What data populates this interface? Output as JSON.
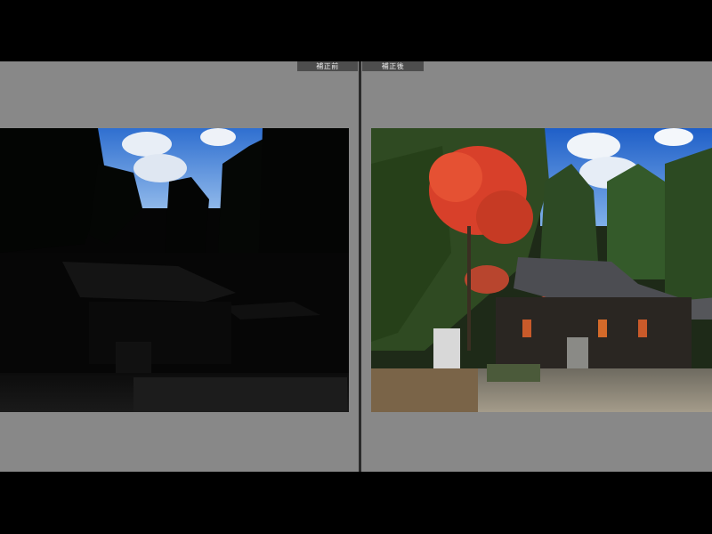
{
  "compare_view": {
    "before_label": "補正前",
    "after_label": "補正後"
  },
  "colors": {
    "pane_background": "#888888",
    "label_background": "#4d4d4d",
    "label_text": "#e8e8e8",
    "divider": "#2a2a2a"
  }
}
